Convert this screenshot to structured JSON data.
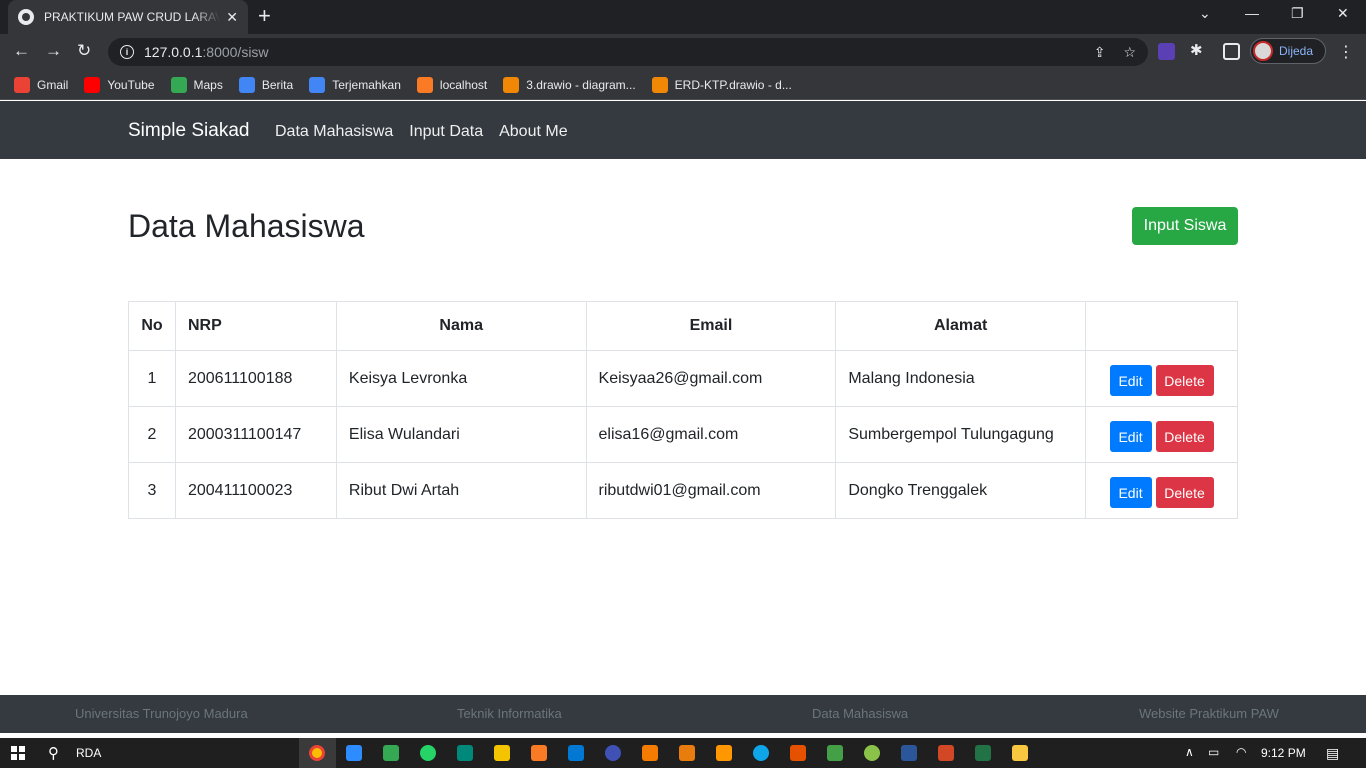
{
  "browser": {
    "tab_title": "PRAKTIKUM PAW CRUD LARAVEL",
    "tab_close": "✕",
    "new_tab": "+",
    "url_host": "127.0.0.1",
    "url_path": ":8000/sisw",
    "profile_name": "Dijeda",
    "bookmarks": [
      {
        "label": "Gmail",
        "icon": "gmail-icon",
        "color": "#ea4335"
      },
      {
        "label": "YouTube",
        "icon": "youtube-icon",
        "color": "#ff0000"
      },
      {
        "label": "Maps",
        "icon": "maps-icon",
        "color": "#34a853"
      },
      {
        "label": "Berita",
        "icon": "news-icon",
        "color": "#4285f4"
      },
      {
        "label": "Terjemahkan",
        "icon": "translate-icon",
        "color": "#4285f4"
      },
      {
        "label": "localhost",
        "icon": "xampp-icon",
        "color": "#fb7a24"
      },
      {
        "label": "3.drawio - diagram...",
        "icon": "drawio-icon",
        "color": "#f08705"
      },
      {
        "label": "ERD-KTP.drawio - d...",
        "icon": "drawio-icon",
        "color": "#f08705"
      }
    ]
  },
  "navbar": {
    "brand": "Simple Siakad",
    "links": [
      "Data Mahasiswa",
      "Input Data",
      "About Me"
    ]
  },
  "main": {
    "title": "Data Mahasiswa",
    "input_button": "Input Siswa",
    "table": {
      "headers": [
        "No",
        "NRP",
        "Nama",
        "Email",
        "Alamat",
        ""
      ],
      "rows": [
        {
          "no": "1",
          "nrp": "200611100188",
          "nama": "Keisya Levronka",
          "email": "Keisyaa26@gmail.com",
          "alamat": "Malang Indonesia"
        },
        {
          "no": "2",
          "nrp": "2000311100147",
          "nama": "Elisa Wulandari",
          "email": "elisa16@gmail.com",
          "alamat": "Sumbergempol Tulungagung"
        },
        {
          "no": "3",
          "nrp": "200411100023",
          "nama": "Ribut Dwi Artah",
          "email": "ributdwi01@gmail.com",
          "alamat": "Dongko Trenggalek"
        }
      ],
      "edit_label": "Edit",
      "delete_label": "Delete"
    }
  },
  "footer": {
    "items": [
      "Universitas Trunojoyo Madura",
      "Teknik Informatika",
      "Data Mahasiswa",
      "Website Praktikum PAW"
    ]
  },
  "taskbar": {
    "search_text": "RDA",
    "time": "9:12 PM"
  },
  "colors": {
    "navbar": "#343a40",
    "success": "#28a745",
    "primary": "#007bff",
    "danger": "#dc3545"
  }
}
